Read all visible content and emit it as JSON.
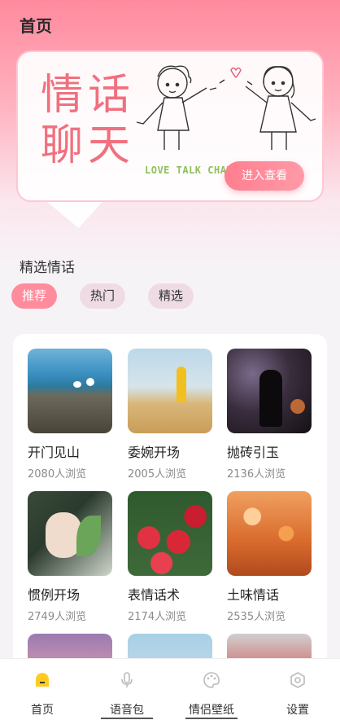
{
  "header": {
    "title": "首页"
  },
  "banner": {
    "title_line1": "情话",
    "title_line2": "聊天",
    "subtitle": "LOVE TALK CHAT",
    "button_label": "进入查看"
  },
  "section": {
    "title": "精选情话"
  },
  "tabs": [
    {
      "label": "推荐",
      "active": true
    },
    {
      "label": "热门",
      "active": false
    },
    {
      "label": "精选",
      "active": false
    }
  ],
  "items": [
    {
      "title": "开门见山",
      "views": "2080人浏览",
      "image": "seagulls-on-rocks"
    },
    {
      "title": "委婉开场",
      "views": "2005人浏览",
      "image": "girl-in-field"
    },
    {
      "title": "抛砖引玉",
      "views": "2136人浏览",
      "image": "silhouette-sparkles"
    },
    {
      "title": "惯例开场",
      "views": "2749人浏览",
      "image": "girl-with-leaves"
    },
    {
      "title": "表情话术",
      "views": "2174人浏览",
      "image": "red-roses"
    },
    {
      "title": "土味情话",
      "views": "2535人浏览",
      "image": "orange-flowers"
    }
  ],
  "tabbar": [
    {
      "label": "首页",
      "icon": "home-icon",
      "active": true
    },
    {
      "label": "语音包",
      "icon": "microphone-icon",
      "active": false
    },
    {
      "label": "情侣壁纸",
      "icon": "palette-icon",
      "active": false
    },
    {
      "label": "设置",
      "icon": "settings-icon",
      "active": false
    }
  ],
  "colors": {
    "accent": "#ff8c9c",
    "banner_title": "#f0707f",
    "subtitle": "#8fc05a"
  }
}
